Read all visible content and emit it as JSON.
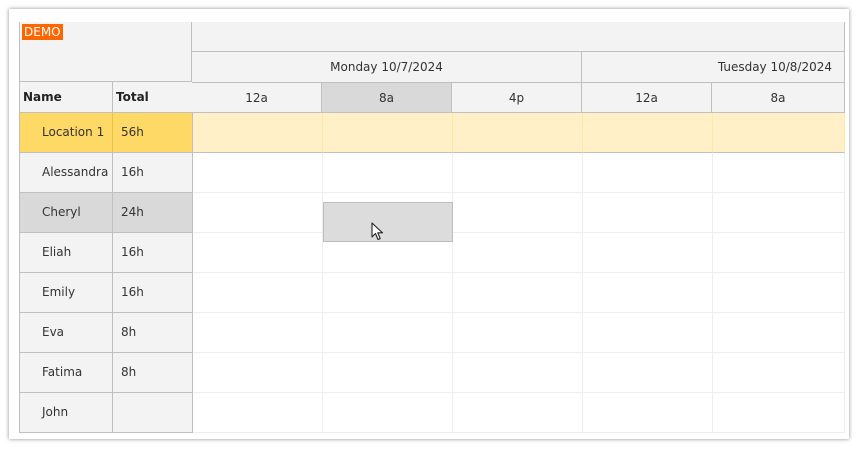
{
  "demo_label": "DEMO",
  "headers": {
    "name": "Name",
    "total": "Total"
  },
  "days": [
    {
      "label": "Monday 10/7/2024"
    },
    {
      "label": "Tuesday 10/8/2024"
    }
  ],
  "time_slots": [
    "12a",
    "8a",
    "4p",
    "12a",
    "8a"
  ],
  "rows": [
    {
      "name": "Location 1",
      "total": "56h",
      "type": "group"
    },
    {
      "name": "Alessandra",
      "total": "16h"
    },
    {
      "name": "Cheryl",
      "total": "24h",
      "selected": true
    },
    {
      "name": "Eliah",
      "total": "16h"
    },
    {
      "name": "Emily",
      "total": "16h"
    },
    {
      "name": "Eva",
      "total": "8h"
    },
    {
      "name": "Fatima",
      "total": "8h"
    },
    {
      "name": "John",
      "total": ""
    }
  ],
  "colors": {
    "group_row_header": "#ffd966",
    "group_row_cells": "#fff0c8",
    "selected_row_header": "#d9d9d9",
    "highlight_cell": "#dcdcdc",
    "demo_badge": "#ff6600"
  },
  "icons": {
    "cursor": "mouse-pointer-icon"
  }
}
